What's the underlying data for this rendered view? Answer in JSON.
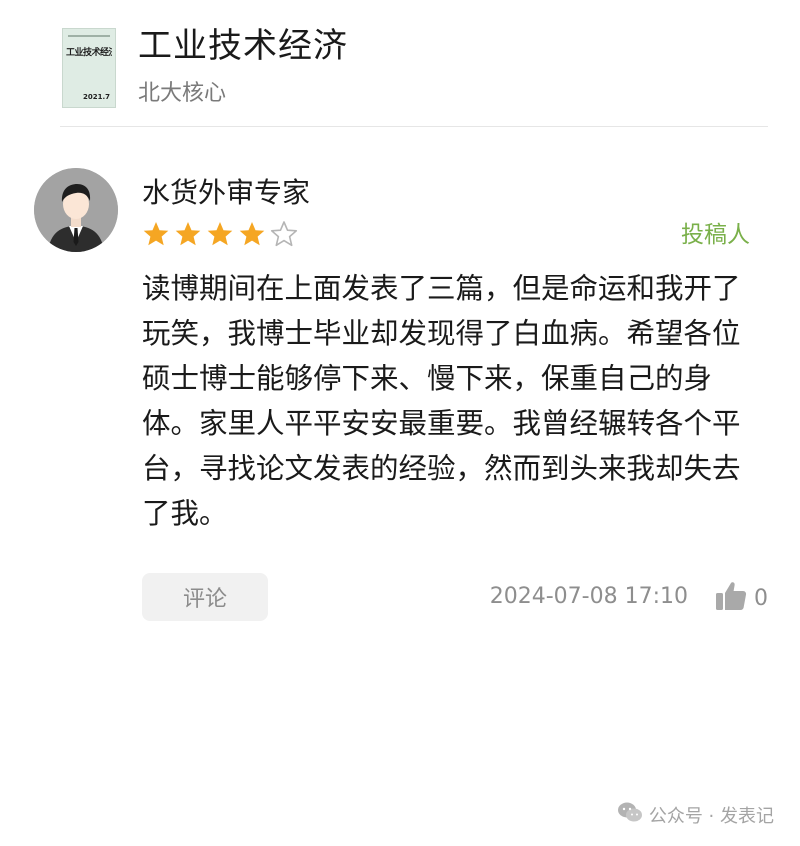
{
  "journal": {
    "cover_title": "工业技术经济",
    "cover_issue": "2021.7",
    "title": "工业技术经济",
    "subtitle": "北大核心"
  },
  "review": {
    "reviewer_name": "水货外审专家",
    "rating": 4,
    "rating_max": 5,
    "role_tag": "投稿人",
    "body": "读博期间在上面发表了三篇，但是命运和我开了玩笑，我博士毕业却发现得了白血病。希望各位硕士博士能够停下来、慢下来，保重自己的身体。家里人平平安安最重要。我曾经辗转各个平台，寻找论文发表的经验，然而到头来我却失去了我。",
    "comment_label": "评论",
    "date": "2024-07-08 17:10",
    "like_count": "0"
  },
  "watermark": {
    "text": "公众号 · 发表记"
  },
  "colors": {
    "star_filled": "#f5a623",
    "star_empty": "#b5b5b5",
    "role_tag": "#7ab04a",
    "avatar_bg": "#a3a3a3"
  },
  "icons": {
    "avatar": "user-avatar-icon",
    "star": "star-icon",
    "like": "thumbs-up-icon",
    "watermark": "wechat-icon"
  }
}
